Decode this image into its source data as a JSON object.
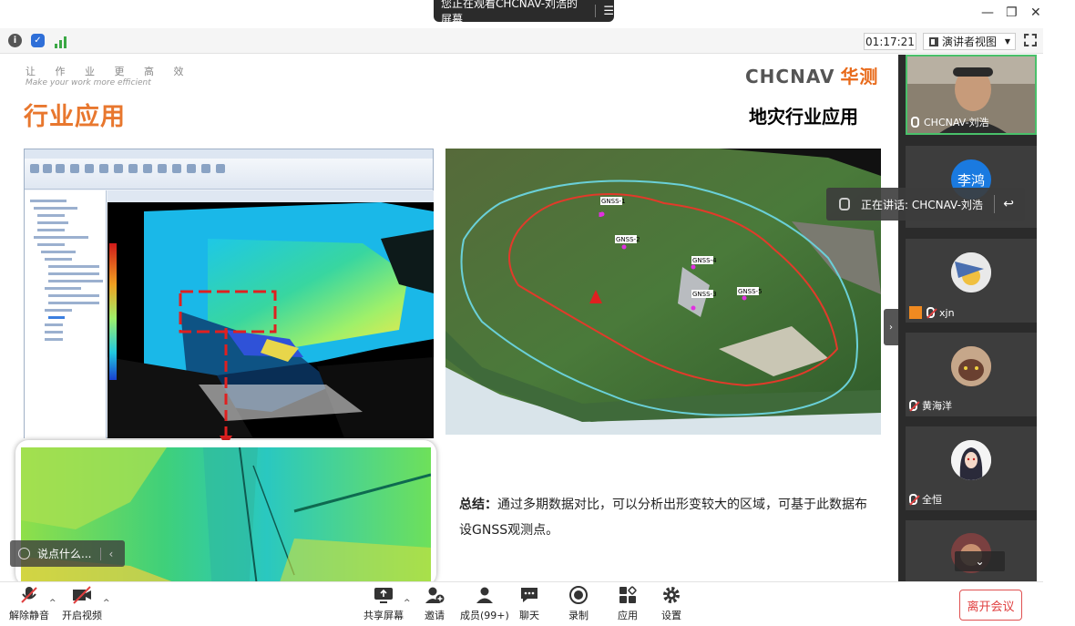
{
  "window": {
    "share_banner": "您正在观看CHCNAV-刘浩的屏幕",
    "min": "—",
    "restore": "❐",
    "close": "✕"
  },
  "infobar": {
    "timer": "01:17:21",
    "view_mode": "演讲者视图"
  },
  "slide": {
    "slogan": "让 作 业 更 高 效",
    "slogan_en": "Make your work more efficient",
    "section_title": "行业应用",
    "brand_en": "CHCNAV",
    "brand_cn": "华测",
    "heading": "地灾行业应用",
    "summary_label": "总结：",
    "summary_text": "通过多期数据对比，可以分析出形变较大的区域，可基于此数据布设GNSS观测点。",
    "gnss_labels": [
      "GNSS-1",
      "GNSS-2",
      "GNSS-4",
      "GNSS-3",
      "GNSS-5"
    ]
  },
  "chat": {
    "placeholder": "说点什么..."
  },
  "participants": {
    "speaking_notice": "正在讲话: CHCNAV-刘浩",
    "tiles": [
      {
        "name": "CHCNAV-刘浩",
        "muted": false
      },
      {
        "name": "李鸿",
        "muted": true
      },
      {
        "name": "xjn",
        "muted": true
      },
      {
        "name": "黄海洋",
        "muted": true
      },
      {
        "name": "全恒",
        "muted": true
      }
    ]
  },
  "toolbar": {
    "unmute": "解除静音",
    "start_video": "开启视频",
    "share_screen": "共享屏幕",
    "invite": "邀请",
    "members": "成员(99+)",
    "chat": "聊天",
    "record": "录制",
    "apps": "应用",
    "settings": "设置",
    "end_meeting": "离开会议"
  },
  "colors": {
    "accent_orange": "#e8772e",
    "end_red": "#e04040",
    "panel_bg": "#2b2b2b"
  }
}
